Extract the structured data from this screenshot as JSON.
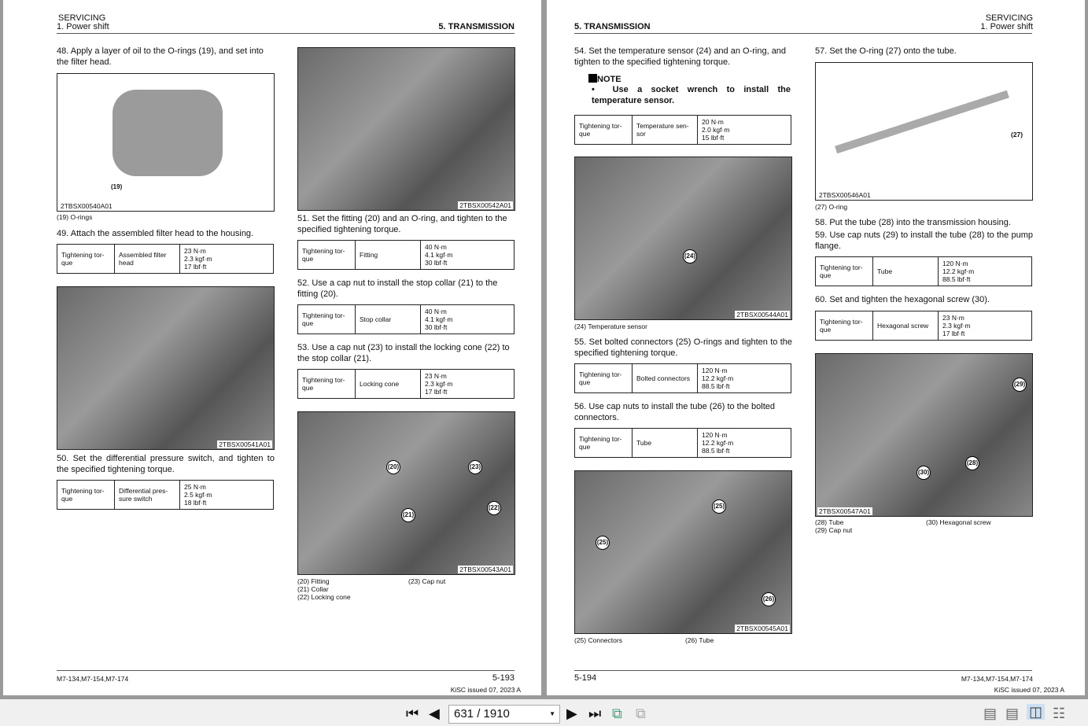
{
  "left": {
    "header_section": "SERVICING",
    "header_sub": "1. Power shift",
    "header_chapter": "5. TRANSMISSION",
    "s48": "48. Apply a layer of oil to the O-rings (19), and set into the filter head.",
    "img1": {
      "code": "2TBSX00540A01",
      "callout": "(19)",
      "caption": "(19) O-rings"
    },
    "s49": "49. Attach the assembled filter head to the housing.",
    "t49": [
      "Tightening tor-que",
      "Assembled filter head",
      "23 N·m",
      "2.3 kgf·m",
      "17 lbf·ft"
    ],
    "img2": {
      "code": "2TBSX00541A01"
    },
    "s50": "50. Set the differential pressure switch, and tighten to the specified tightening torque.",
    "t50": [
      "Tightening tor-que",
      "Differential pres-sure switch",
      "25 N·m",
      "2.5 kgf·m",
      "18 lbf·ft"
    ],
    "img3": {
      "code": "2TBSX00542A01"
    },
    "s51": "51. Set the fitting (20) and an O-ring, and tighten to the specified tightening torque.",
    "t51": [
      "Tightening tor-que",
      "Fitting",
      "40 N·m",
      "4.1 kgf·m",
      "30 lbf·ft"
    ],
    "s52": "52. Use a cap nut to install the stop collar (21) to the fitting (20).",
    "t52": [
      "Tightening tor-que",
      "Stop collar",
      "40 N·m",
      "4.1 kgf·m",
      "30 lbf·ft"
    ],
    "s53": "53. Use a cap nut (23) to install the locking cone (22) to the stop collar (21).",
    "t53": [
      "Tightening tor-que",
      "Locking cone",
      "23 N·m",
      "2.3 kgf·m",
      "17 lbf·ft"
    ],
    "img4": {
      "code": "2TBSX00543A01",
      "callouts": [
        "(20)",
        "(23)",
        "(21)",
        "(22)"
      ],
      "captions": [
        "(20) Fitting",
        "(21) Collar",
        "(22) Locking cone",
        "(23) Cap nut"
      ]
    },
    "footer_model": "M7-134,M7-154,M7-174",
    "footer_page": "5-193",
    "footer_issue": "KiSC issued 07, 2023 A"
  },
  "right": {
    "header_section": "SERVICING",
    "header_sub": "1. Power shift",
    "header_chapter": "5. TRANSMISSION",
    "s54": "54. Set the temperature sensor (24) and an O-ring, and tighten to the specified tightening torque.",
    "note_title": "NOTE",
    "note_text": "Use a socket wrench to install the temperature sensor.",
    "t54": [
      "Tightening tor-que",
      "Temperature sen-sor",
      "20 N·m",
      "2.0 kgf·m",
      "15 lbf·ft"
    ],
    "img1": {
      "code": "2TBSX00544A01",
      "callout": "(24)",
      "caption": "(24) Temperature sensor"
    },
    "s55": "55. Set bolted connectors (25) O-rings and tighten to the specified tightening torque.",
    "t55": [
      "Tightening tor-que",
      "Bolted connectors",
      "120 N·m",
      "12.2 kgf·m",
      "88.5 lbf·ft"
    ],
    "s56": "56. Use cap nuts to install the tube (26) to the bolted connectors.",
    "t56": [
      "Tightening tor-que",
      "Tube",
      "120 N·m",
      "12.2 kgf·m",
      "88.5 lbf·ft"
    ],
    "img2": {
      "code": "2TBSX00545A01",
      "callouts": [
        "(25)",
        "(25)",
        "(26)"
      ],
      "captions": [
        "(25) Connectors",
        "(26) Tube"
      ]
    },
    "s57": "57. Set the O-ring (27) onto the tube.",
    "img3": {
      "code": "2TBSX00546A01",
      "callout": "(27)",
      "caption": "(27) O-ring"
    },
    "s58": "58. Put the tube (28) into the transmission housing.",
    "s59": "59. Use cap nuts (29) to install the tube (28) to the pump flange.",
    "t59": [
      "Tightening tor-que",
      "Tube",
      "120 N·m",
      "12.2 kgf·m",
      "88.5 lbf·ft"
    ],
    "s60": "60. Set and tighten the hexagonal screw (30).",
    "t60": [
      "Tightening tor-que",
      "Hexagonal screw",
      "23 N·m",
      "2.3 kgf·m",
      "17 lbf·ft"
    ],
    "img4": {
      "code": "2TBSX00547A01",
      "callouts": [
        "(29)",
        "(28)",
        "(30)"
      ],
      "captions": [
        "(28) Tube",
        "(29) Cap nut",
        "(30) Hexagonal screw"
      ]
    },
    "footer_model": "M7-134,M7-154,M7-174",
    "footer_page": "5-194",
    "footer_issue": "KiSC issued 07, 2023 A"
  },
  "toolbar": {
    "page_indicator": "631 / 1910",
    "icons": [
      "first-page-icon",
      "prev-page-icon",
      "next-page-icon",
      "last-page-icon",
      "go-back-view-icon",
      "go-forward-view-icon",
      "single-page-icon",
      "continuous-icon",
      "two-page-icon",
      "two-page-continuous-icon"
    ]
  }
}
